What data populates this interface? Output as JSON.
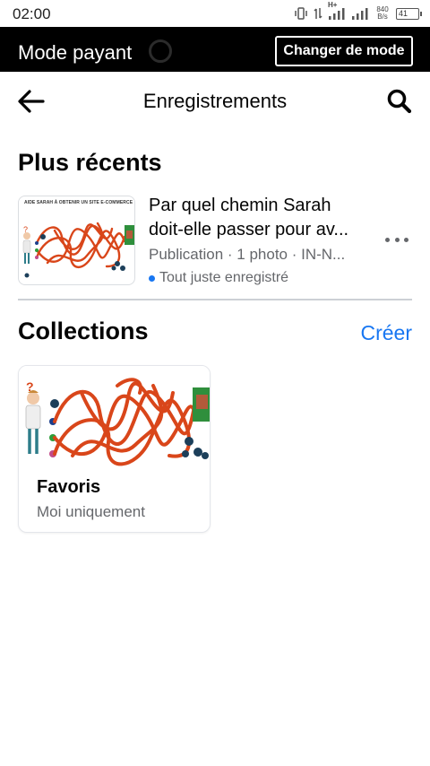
{
  "status_bar": {
    "time": "02:00",
    "net_speed_value": "840",
    "net_speed_unit": "B/s",
    "network_type": "H+",
    "battery_level": "41",
    "icons": [
      "vibrate-icon",
      "data-arrows-icon",
      "signal-icon",
      "signal-icon",
      "battery-icon"
    ]
  },
  "mode_banner": {
    "label": "Mode payant",
    "button_label": "Changer de mode"
  },
  "header": {
    "title": "Enregistrements",
    "back_icon": "arrow-left-icon",
    "search_icon": "search-icon"
  },
  "recent": {
    "section_title": "Plus récents",
    "item": {
      "thumbnail_caption": "AIDE SARAH À OBTENIR UN SITE E-COMMERCE",
      "title_line1": "Par quel chemin Sarah",
      "title_line2": "doit-elle passer pour av...",
      "meta": "Publication · 1 photo · IN-N...",
      "status": "Tout juste enregistré",
      "more_icon": "more-dots-icon"
    }
  },
  "collections": {
    "section_title": "Collections",
    "create_label": "Créer",
    "items": [
      {
        "name": "Favoris",
        "privacy": "Moi uniquement"
      }
    ]
  },
  "colors": {
    "accent": "#1877f2",
    "banner_bg": "#000000",
    "maze_line": "#d9461a",
    "secondary_text": "#65676b"
  }
}
